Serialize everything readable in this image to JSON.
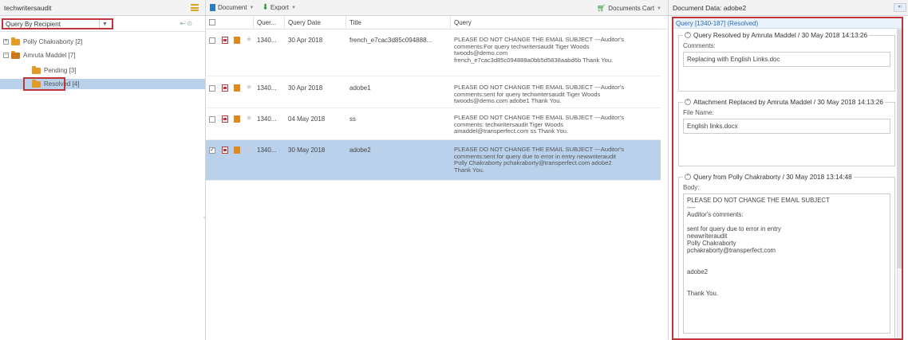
{
  "left": {
    "title": "techwritersaudit",
    "filter_value": "Query By Recipient",
    "tree": [
      {
        "label": "Polly Chakraborty [2]",
        "expander": "+"
      },
      {
        "label": "Amruta Maddel [7]",
        "expander": "−"
      },
      {
        "label": "Pending [3]"
      },
      {
        "label": "Resolved [4]"
      }
    ]
  },
  "toolbar": {
    "document_label": "Document",
    "export_label": "Export",
    "cart_label": "Documents Cart"
  },
  "table": {
    "columns": {
      "query": "Quer...",
      "date": "Query Date",
      "title": "Title",
      "text": "Query"
    },
    "rows": [
      {
        "query": "1340...",
        "date": "30 Apr 2018",
        "title": "french_e7cac3d85c094888...",
        "text": "PLEASE DO NOT CHANGE THE EMAIL SUBJECT ---Auditor's\ncomments:For query techwritersaudit Tiger Woods\ntwoods@demo.com\nfrench_e7cac3d85c094888a0bb5d5838aabd6b Thank You."
      },
      {
        "query": "1340...",
        "date": "30 Apr 2018",
        "title": "adobe1",
        "text": "PLEASE DO NOT CHANGE THE EMAIL SUBJECT ---Auditor's\ncomments:sent for query techwritersaudit Tiger Woods\ntwoods@demo.com   adobe1 Thank You."
      },
      {
        "query": "1340...",
        "date": "04 May 2018",
        "title": "ss",
        "text": "PLEASE DO NOT CHANGE THE EMAIL SUBJECT ---Auditor's\ncomments: techwritersaudit Tiger Woods\namaddel@transperfect.com   ss Thank You."
      },
      {
        "query": "1340...",
        "date": "30 May 2018",
        "title": "adobe2",
        "text": "PLEASE DO NOT CHANGE THE EMAIL SUBJECT ---Auditor's\ncomments:sent for query due to error in entry newwriteraudit\nPolly Chakraborty pchakraborty@transperfect.com    adobe2\nThank You."
      }
    ]
  },
  "right": {
    "title": "Document Data: adobe2",
    "detail_title": "Query [1340-187] (Resolved)",
    "sections": {
      "resolved": {
        "legend": "Query Resolved by Amruta Maddel / 30 May 2018 14:13:26",
        "label": "Comments:",
        "value": "Replacing with English Links.doc"
      },
      "attachment": {
        "legend": "Attachment Replaced by Amruta Maddel / 30 May 2018 14:13:26",
        "label": "File Name:",
        "value": "English links.docx"
      },
      "query": {
        "legend": "Query from Polly Chakraborty / 30 May 2018 13:14:48",
        "label": "Body:",
        "value": "PLEASE DO NOT CHANGE THE EMAIL SUBJECT\n----\nAuditor's comments:\n\nsent for query due to error in entry\nnewwriteraudit\nPolly Chakraborty\npchakraborty@transperfect.com\n\n\nadobe2\n\n\nThank You."
      }
    }
  },
  "colors": {
    "highlight": "#c0353a",
    "selection": "#b9d1ea",
    "folder": "#e39b25",
    "link": "#2b6cb3"
  }
}
